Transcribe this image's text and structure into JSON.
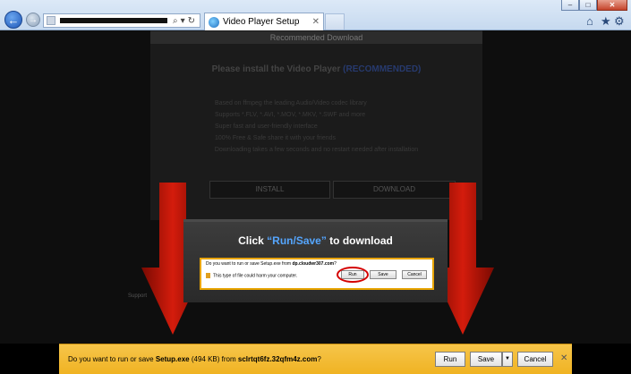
{
  "browser": {
    "tab_title": "Video Player Setup",
    "window_controls": {
      "minimize": "–",
      "maximize": "□",
      "close": "✕"
    },
    "icons": [
      "back-icon",
      "forward-icon",
      "search-icon",
      "refresh-icon",
      "home-icon",
      "star-icon",
      "gear-icon"
    ]
  },
  "background_page": {
    "header": "Recommended Download",
    "title_main": "Please install the Video Player ",
    "title_accent": "(RECOMMENDED)",
    "features": [
      "Based on ffmpeg the leading Audio/Video codec library",
      "Supports *.FLV, *.AVI, *.MOV, *.MKV, *.SWF and more",
      "Super fast and user-friendly interface",
      "100% Free & Safe share it with your friends",
      "Downloading takes a few seconds and no restart needed after installation"
    ],
    "install_button": "INSTALL",
    "download_button": "DOWNLOAD",
    "support_label": "Support"
  },
  "overlay": {
    "prefix": "Click ",
    "highlight": "“Run/Save”",
    "suffix": " to download",
    "mini_prompt": {
      "question_prefix": "Do you want to run or save Setup.exe from ",
      "question_domain": "dp.cloudwr307.com",
      "question_suffix": "?",
      "warning": "This type of file could harm your computer.",
      "run": "Run",
      "save": "Save",
      "cancel": "Cancel"
    }
  },
  "download_bar": {
    "text_prefix": "Do you want to run or save ",
    "filename": "Setup.exe",
    "size": " (494 KB) from ",
    "domain": "sclrtqt6fz.32qfm4z.com",
    "text_suffix": "?",
    "run": "Run",
    "save": "Save",
    "save_dropdown": "▼",
    "cancel": "Cancel",
    "close": "✕"
  },
  "colors": {
    "download_bar": "#f0b323",
    "highlight": "#55a6ff",
    "arrow_red": "#cc1a0a"
  }
}
